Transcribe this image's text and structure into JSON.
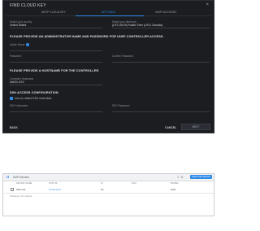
{
  "wizard": {
    "title": "FIND CLOUD KEY",
    "close": "×",
    "steps": [
      "SMTP CLOUD KEY",
      "SETTINGS",
      "UNIFI ACCOUNT"
    ],
    "country_label": "Select your country",
    "country_value": "United States",
    "timezone_label": "Select your timezone",
    "timezone_value": "(UTC-08:00) Pacific Time (US & Canada)",
    "admin_section": "PLEASE PROVIDE AN ADMINISTRATOR NAME AND PASSWORD FOR UNIFI CONTROLLER ACCESS.",
    "admin_name_label": "Admin Name",
    "password_label": "Password",
    "confirm_label": "Confirm Password",
    "hostname_section": "PLEASE PROVIDE A HOSTNAME FOR THE CONTROLLER.",
    "hostname_label": "Controller Hostname",
    "hostname_value": "UbiCK-XXX",
    "ssh_section": "SSH ACCESS CONFIGURATION",
    "ssh_checkbox_label": "Use our default SSH credentials",
    "ssh_user_label": "SSH Username",
    "ssh_pass_label": "SSH Password",
    "back": "BACK",
    "cancel": "CANCEL",
    "next": "NEXT",
    "accent_color": "#2e8be8"
  },
  "devices": {
    "logo": "U",
    "title": "UniFi Devices",
    "add_button": "Add UniFi Device",
    "columns": [
      "DEVICE NAME",
      "STATUS",
      "IP",
      "MAC",
      "MODEL"
    ],
    "rows": [
      {
        "name": "UCK-G2",
        "status": "Connected",
        "ip": "10.",
        "mac": "",
        "model": "UCK"
      }
    ],
    "footer": "Showing 1 of 1 device"
  }
}
